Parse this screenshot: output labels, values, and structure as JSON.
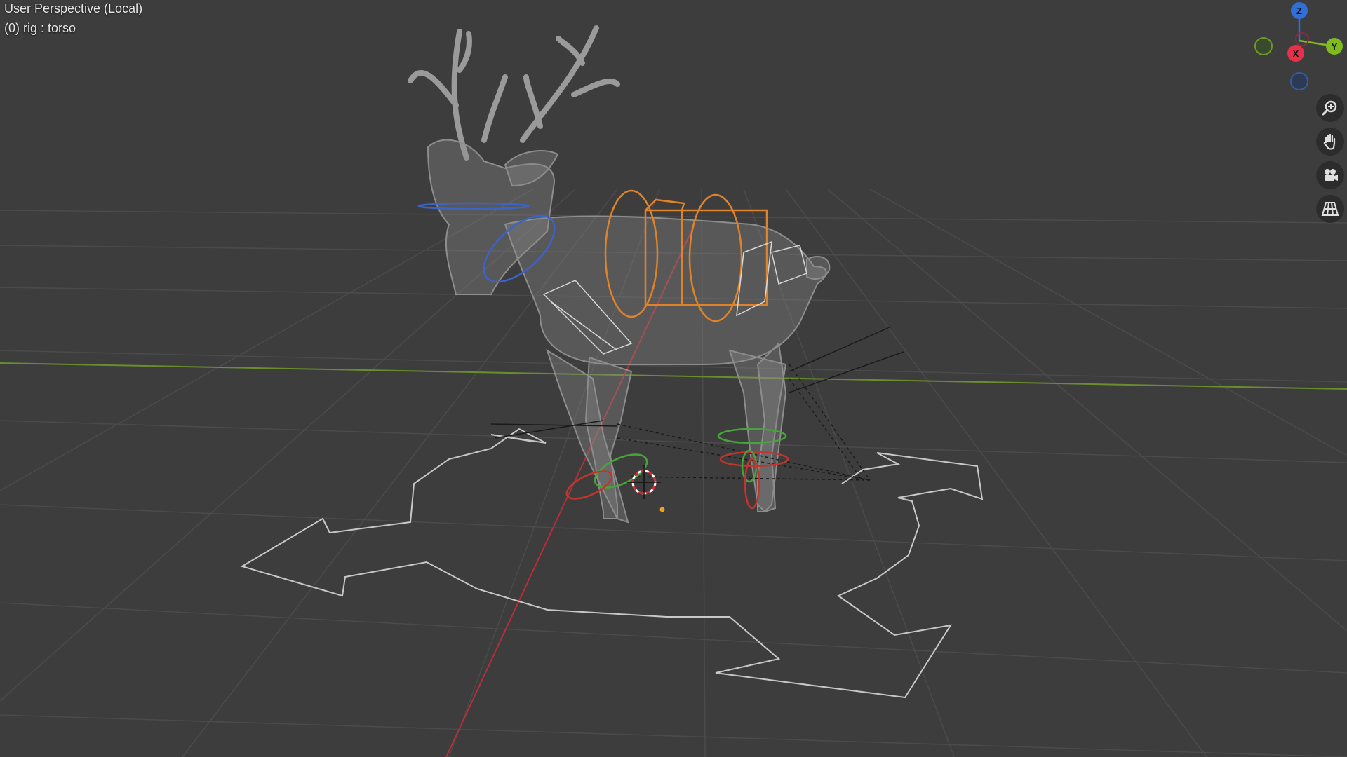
{
  "viewport": {
    "title": "User Perspective (Local)",
    "subtitle": "(0) rig : torso"
  },
  "gizmo": {
    "axes": [
      {
        "label": "Z",
        "color": "#2f6fd6"
      },
      {
        "label": "X",
        "color": "#e8304a"
      },
      {
        "label": "Y",
        "color": "#7dbb1f"
      }
    ],
    "negative_axes": [
      {
        "name": "neg-y",
        "color": "#6a9a2a"
      },
      {
        "name": "neg-z",
        "color": "#2f5f9e"
      },
      {
        "name": "neg-x",
        "color": "#8a2a3a"
      }
    ]
  },
  "nav_buttons": [
    "zoom-icon",
    "hand-pan-icon",
    "camera-icon",
    "ortho-grid-icon"
  ],
  "colors": {
    "background": "#3d3d3d",
    "grid": "#4a4a4a",
    "x_axis": "#b3303a",
    "y_axis": "#6a8d2e",
    "bone_orange": "#e0822a",
    "bone_blue": "#3c63c8",
    "bone_green": "#47a43a",
    "bone_red": "#c0352d",
    "mesh": "#8a8a8a"
  }
}
